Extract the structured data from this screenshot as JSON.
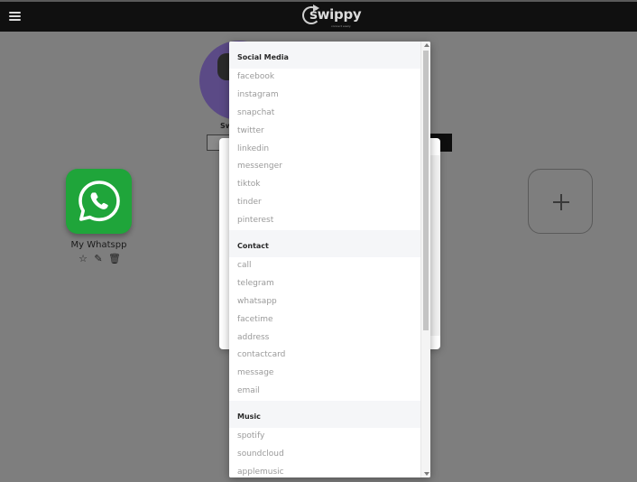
{
  "header": {
    "brand": "swippy",
    "tagline": "connect easily",
    "menu_icon": "hamburger-menu-icon"
  },
  "profile": {
    "name_partial": "Sw"
  },
  "links": [
    {
      "label": "My Whatspp",
      "icon": "whatsapp-icon",
      "color": "#1fa53a",
      "actions": [
        "star-icon",
        "edit-icon",
        "trash-icon"
      ]
    }
  ],
  "add_tile": {
    "icon": "plus-icon"
  },
  "dropdown": {
    "groups": [
      {
        "label": "Social Media",
        "items": [
          "facebook",
          "instagram",
          "snapchat",
          "twitter",
          "linkedin",
          "messenger",
          "tiktok",
          "tinder",
          "pinterest"
        ]
      },
      {
        "label": "Contact",
        "items": [
          "call",
          "telegram",
          "whatsapp",
          "facetime",
          "address",
          "contactcard",
          "message",
          "email"
        ]
      },
      {
        "label": "Music",
        "items": [
          "spotify",
          "soundcloud",
          "applemusic"
        ]
      }
    ]
  }
}
